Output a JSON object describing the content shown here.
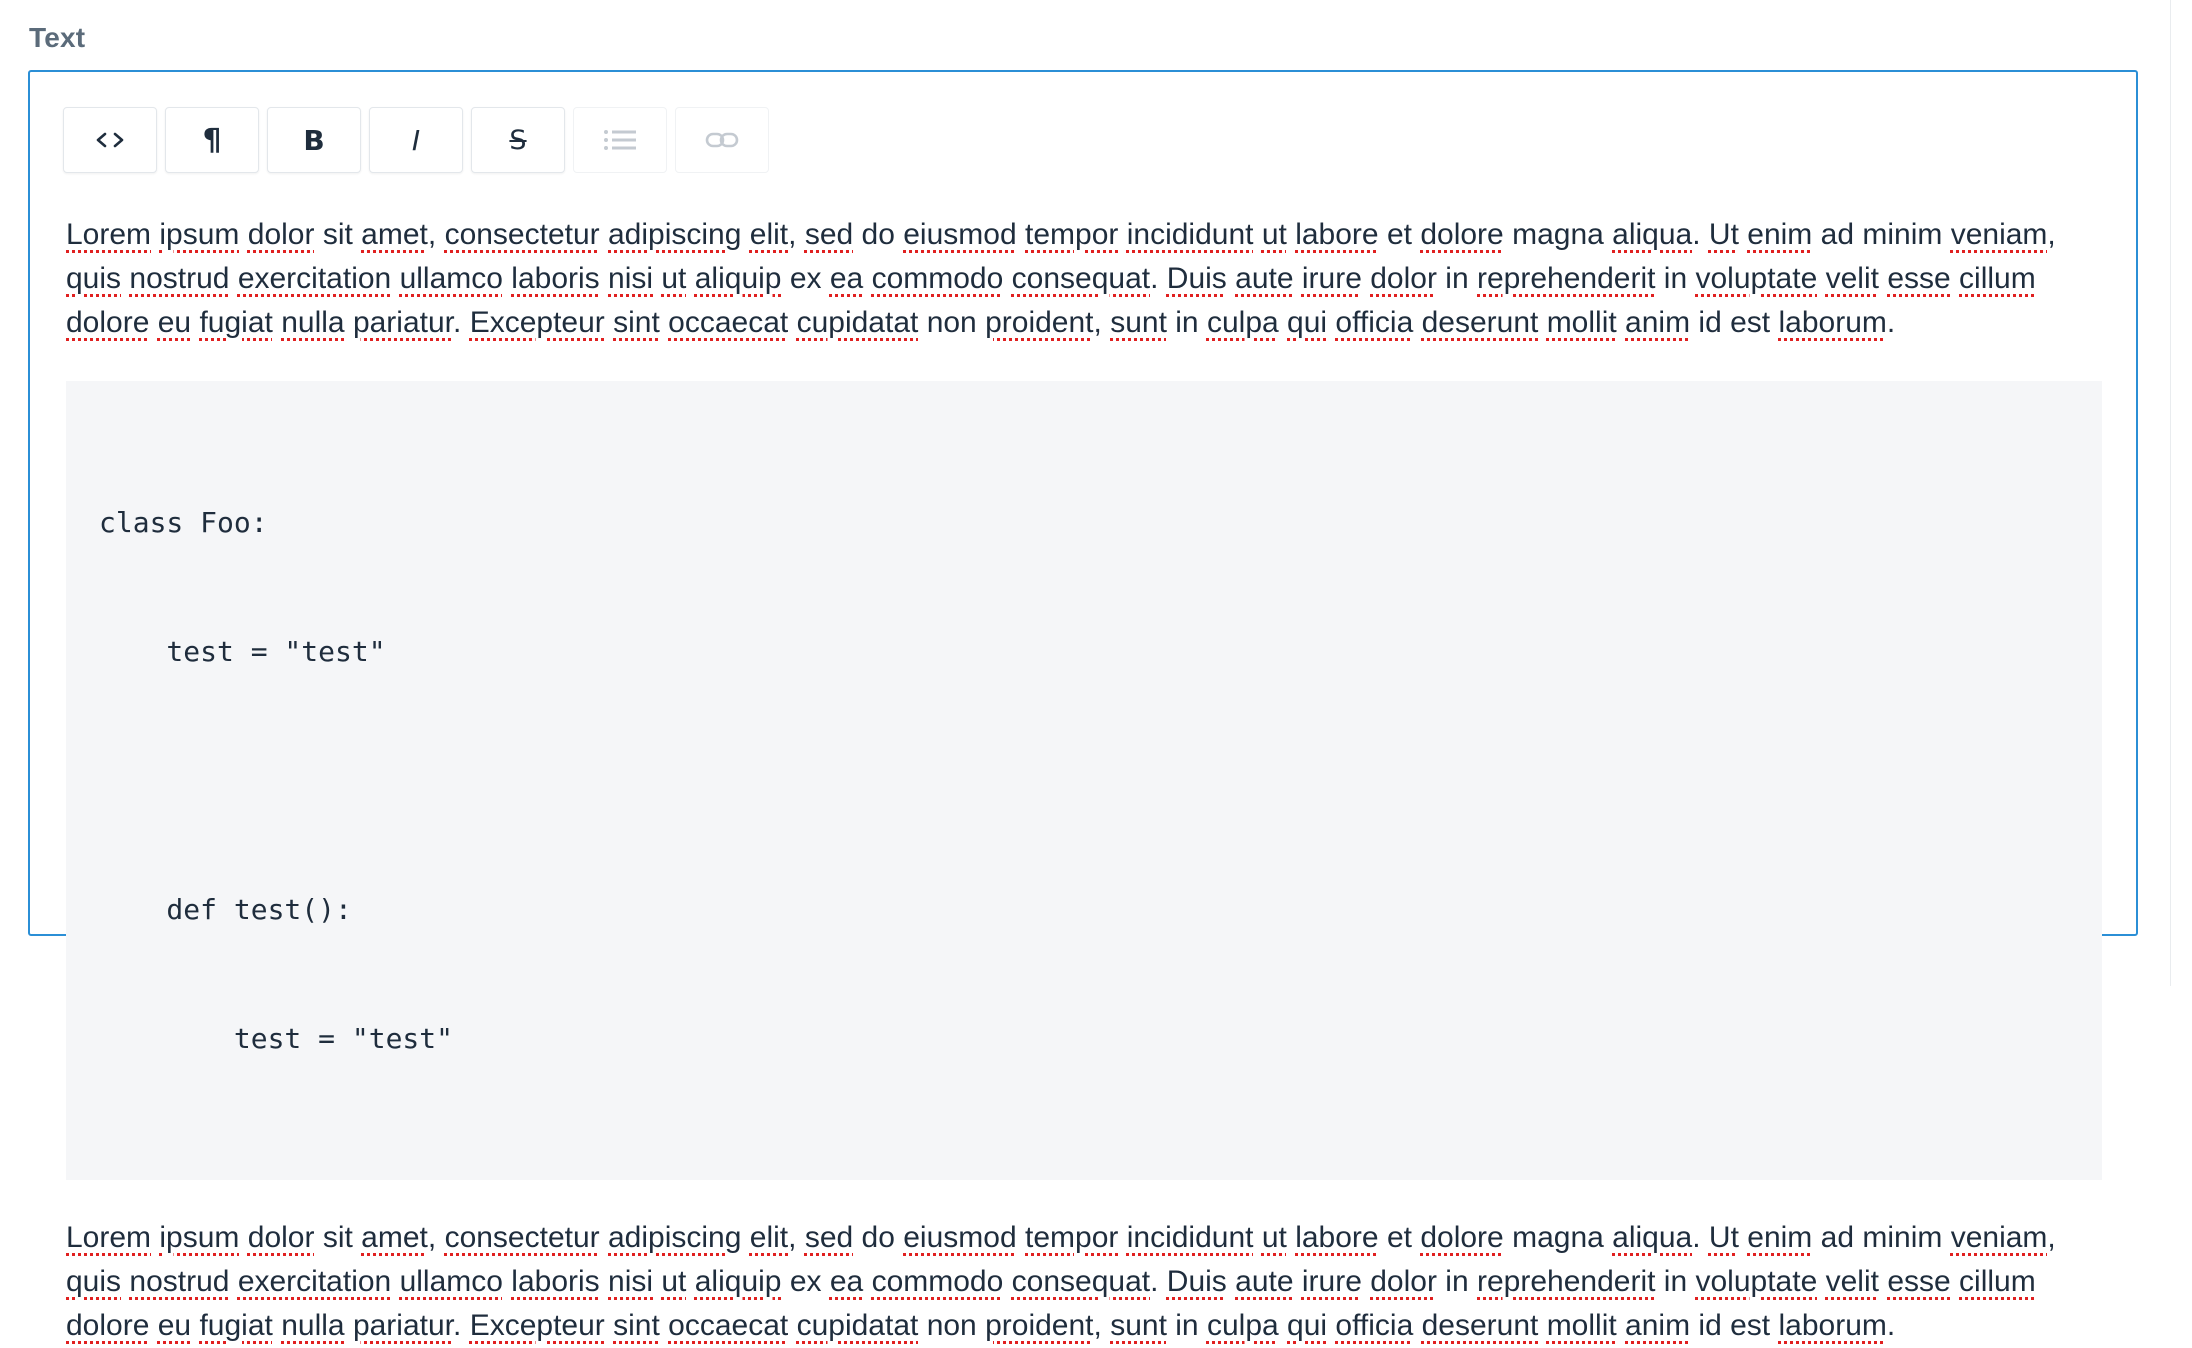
{
  "field": {
    "label": "Text"
  },
  "toolbar": {
    "buttons": [
      {
        "name": "code-button",
        "icon": "code-icon",
        "enabled": true
      },
      {
        "name": "paragraph-button",
        "icon": "paragraph-icon",
        "enabled": true
      },
      {
        "name": "bold-button",
        "icon": "bold-icon",
        "enabled": true
      },
      {
        "name": "italic-button",
        "icon": "italic-icon",
        "enabled": true
      },
      {
        "name": "strikethrough-button",
        "icon": "strikethrough-icon",
        "enabled": true
      },
      {
        "name": "bullet-list-button",
        "icon": "list-icon",
        "enabled": false
      },
      {
        "name": "link-button",
        "icon": "link-icon",
        "enabled": false
      }
    ],
    "glyphs": {
      "paragraph": "¶",
      "bold": "B",
      "italic": "I",
      "strike": "S"
    }
  },
  "content": {
    "paragraph1": "Lorem ipsum dolor sit amet, consectetur adipiscing elit, sed do eiusmod tempor incididunt ut labore et dolore magna aliqua. Ut enim ad minim veniam, quis nostrud exercitation ullamco laboris nisi ut aliquip ex ea commodo consequat. Duis aute irure dolor in reprehenderit in voluptate velit esse cillum dolore eu fugiat nulla pariatur. Excepteur sint occaecat cupidatat non proident, sunt in culpa qui officia deserunt mollit anim id est laborum.",
    "code_lines": [
      "class Foo:",
      "    test = \"test\"",
      "",
      "    def test():",
      "        test = \"test\""
    ],
    "paragraph2": "Lorem ipsum dolor sit amet, consectetur adipiscing elit, sed do eiusmod tempor incididunt ut labore et dolore magna aliqua. Ut enim ad minim veniam, quis nostrud exercitation ullamco laboris nisi ut aliquip ex ea commodo consequat. Duis aute irure dolor in reprehenderit in voluptate velit esse cillum dolore eu fugiat nulla pariatur. Excepteur sint occaecat cupidatat non proident, sunt in culpa qui officia deserunt mollit anim id est laborum."
  },
  "spellcheck_flagged": [
    "Lorem",
    "ipsum",
    "dolor",
    "amet",
    "consectetur",
    "adipiscing",
    "elit",
    "sed",
    "eiusmod",
    "tempor",
    "incididunt",
    "ut",
    "labore",
    "dolore",
    "aliqua",
    "Ut",
    "enim",
    "veniam",
    "quis",
    "nostrud",
    "exercitation",
    "ullamco",
    "laboris",
    "nisi",
    "aliquip",
    "ea",
    "commodo",
    "consequat",
    "Duis",
    "aute",
    "irure",
    "reprehenderit",
    "voluptate",
    "velit",
    "esse",
    "cillum",
    "eu",
    "fugiat",
    "nulla",
    "pariatur",
    "Excepteur",
    "sint",
    "occaecat",
    "cupidatat",
    "proident",
    "sunt",
    "culpa",
    "qui",
    "officia",
    "deserunt",
    "mollit",
    "anim",
    "laborum"
  ],
  "colors": {
    "border_focus": "#2b8fd6",
    "label": "#5b6b7a",
    "text": "#1f2d3d",
    "code_bg": "#f5f6f8",
    "spellcheck": "#e02020",
    "disabled_icon": "#c4cad1"
  }
}
